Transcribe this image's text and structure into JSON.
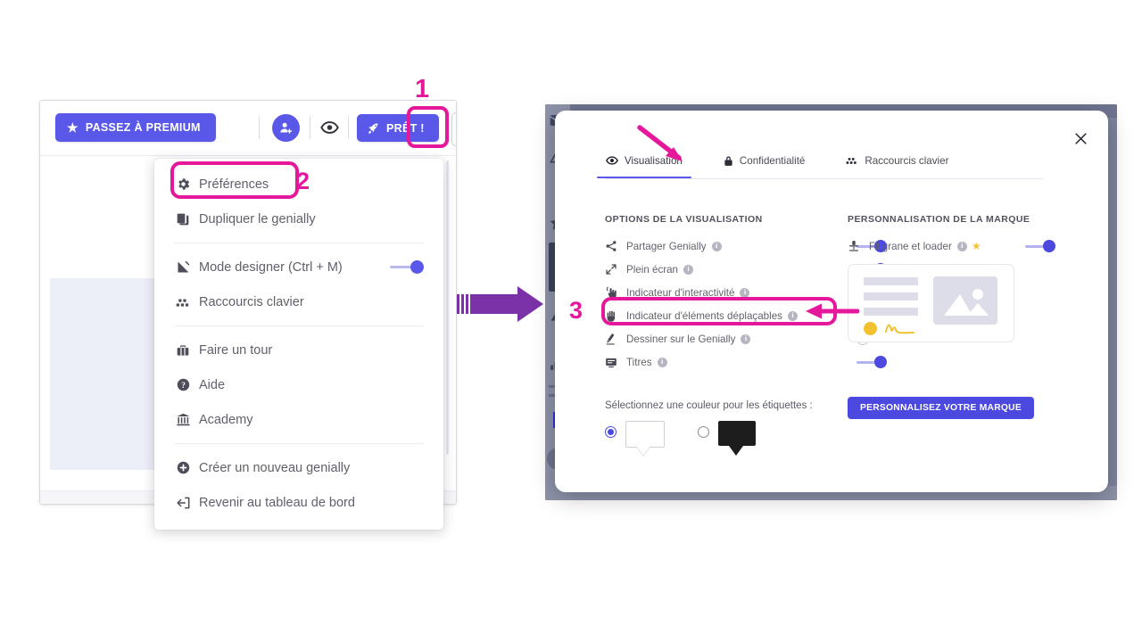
{
  "colors": {
    "brand_purple": "#5a58e8",
    "annotation_pink": "#e5179b",
    "arrow_purple": "#7b32a8",
    "star_yellow": "#f5c138",
    "slide_lavender": "#eceef8"
  },
  "annotations": {
    "step1": "1",
    "step2": "2",
    "step3": "3"
  },
  "editor": {
    "toolbar": {
      "premium_label": "PASSEZ À PREMIUM",
      "premium_icon": "star-icon",
      "share_user_icon": "add-user-icon",
      "preview_icon": "eye-icon",
      "ready_label": "PRÊT !",
      "ready_icon": "rocket-icon",
      "menu_icon": "hamburger-menu-icon"
    },
    "menu": {
      "groups": [
        {
          "items": [
            {
              "label": "Préférences",
              "icon": "gear-icon",
              "toggle": null
            },
            {
              "label": "Dupliquer le genially",
              "icon": "copy-icon",
              "toggle": null
            }
          ]
        },
        {
          "items": [
            {
              "label": "Mode designer (Ctrl + M)",
              "icon": "designer-mode-icon",
              "toggle": "on"
            },
            {
              "label": "Raccourcis clavier",
              "icon": "keyboard-shortcuts-icon",
              "toggle": null
            }
          ]
        },
        {
          "items": [
            {
              "label": "Faire un tour",
              "icon": "tour-icon",
              "toggle": null
            },
            {
              "label": "Aide",
              "icon": "help-icon",
              "toggle": null
            },
            {
              "label": "Academy",
              "icon": "academy-icon",
              "toggle": null
            }
          ]
        },
        {
          "items": [
            {
              "label": "Créer un nouveau genially",
              "icon": "plus-circle-icon",
              "toggle": null
            },
            {
              "label": "Revenir au tableau de bord",
              "icon": "back-to-dashboard-icon",
              "toggle": null
            }
          ]
        }
      ]
    }
  },
  "dialog": {
    "close_icon": "close-icon",
    "tabs": [
      {
        "label": "Visualisation",
        "icon": "eye-icon",
        "active": true
      },
      {
        "label": "Confidentialité",
        "icon": "lock-icon",
        "active": false
      },
      {
        "label": "Raccourcis clavier",
        "icon": "keyboard-shortcuts-icon",
        "active": false
      }
    ],
    "visualisation": {
      "section_title": "OPTIONS DE LA VISUALISATION",
      "options": [
        {
          "label": "Partager Genially",
          "icon": "share-icon",
          "info": "i",
          "state": "on"
        },
        {
          "label": "Plein écran",
          "icon": "fullscreen-icon",
          "info": "i",
          "state": "on"
        },
        {
          "label": "Indicateur d'interactivité",
          "icon": "tap-hand-icon",
          "info": "i",
          "state": "off"
        },
        {
          "label": "Indicateur d'éléments déplaçables",
          "icon": "drag-hand-icon",
          "info": "i",
          "state": "off"
        },
        {
          "label": "Dessiner sur le Genially",
          "icon": "pencil-icon",
          "info": "i",
          "state": "off"
        },
        {
          "label": "Titres",
          "icon": "titles-icon",
          "info": "i",
          "state": "on"
        }
      ],
      "label_color_question": "Sélectionnez une couleur pour les étiquettes :",
      "swatches": [
        {
          "name": "white-label-swatch",
          "color": "#ffffff",
          "selected": true
        },
        {
          "name": "black-label-swatch",
          "color": "#1d1d1d",
          "selected": false
        }
      ]
    },
    "brand": {
      "section_title": "PERSONNALISATION DE LA MARQUE",
      "watermark": {
        "label": "Filigrane et loader",
        "icon": "watermark-icon",
        "info": "i",
        "premium_icon": "star-icon",
        "state": "on"
      },
      "preview_card_name": "brand-preview-card",
      "button_label": "PERSONNALISEZ VOTRE MARQUE"
    }
  }
}
